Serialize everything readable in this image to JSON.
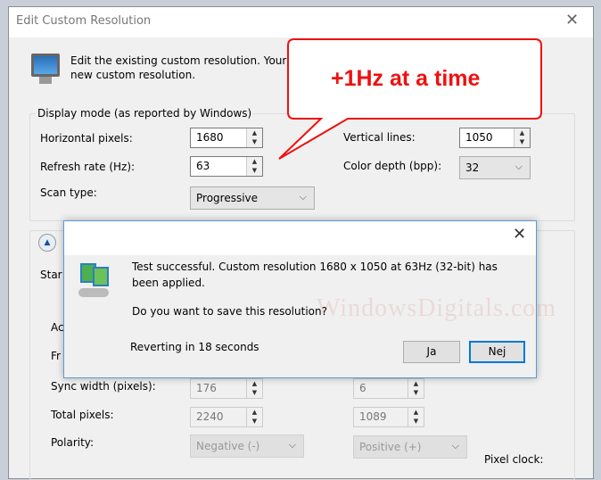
{
  "window": {
    "title": "Edit Custom Resolution",
    "intro_line1": "Edit the existing custom resolution. Your",
    "intro_line2": "new custom resolution."
  },
  "display_mode": {
    "label": "Display mode (as reported by Windows)",
    "horizontal_label": "Horizontal pixels:",
    "horizontal_value": "1680",
    "refresh_label": "Refresh rate (Hz):",
    "refresh_value": "63",
    "scan_label": "Scan type:",
    "scan_value": "Progressive",
    "vertical_label": "Vertical lines:",
    "vertical_value": "1050",
    "depth_label": "Color depth (bpp):",
    "depth_value": "32"
  },
  "callout": {
    "text": "+1Hz at a time",
    "color": "#ee1111"
  },
  "timing": {
    "partial_std": "Star",
    "partial_ac": "Ac",
    "partial_fr": "Fr",
    "sync_label": "Sync width (pixels):",
    "sync_h": "176",
    "sync_v": "6",
    "total_label": "Total pixels:",
    "total_h": "2240",
    "total_v": "1089",
    "polarity_label": "Polarity:",
    "polarity_h": "Negative (-)",
    "polarity_v": "Positive (+)",
    "pixel_clock_label": "Pixel clock:"
  },
  "dialog": {
    "message_line1": "Test successful. Custom resolution 1680 x 1050 at 63Hz (32-bit) has",
    "message_line2": "been applied.",
    "question": "Do you want to save this resolution?",
    "countdown": "Reverting in 18 seconds",
    "yes_label": "Ja",
    "no_label": "Nej"
  },
  "watermark": "WindowsDigitals.com"
}
